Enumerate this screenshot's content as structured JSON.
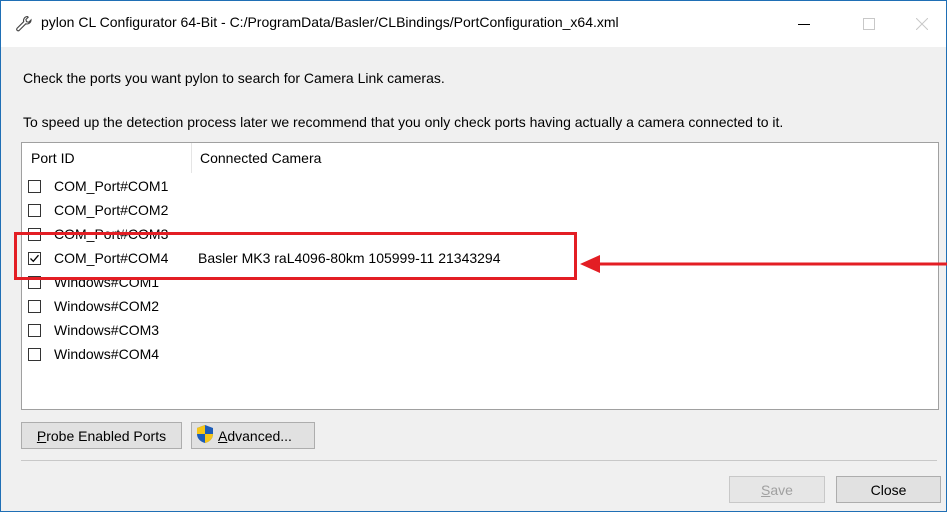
{
  "window": {
    "title": "pylon CL Configurator 64-Bit - C:/ProgramData/Basler/CLBindings/PortConfiguration_x64.xml",
    "icon": "wrench-icon"
  },
  "instructions": {
    "line1": "Check the ports you want pylon to search for Camera Link cameras.",
    "line2": "To speed up the detection process later we recommend that you only check ports having actually a camera connected to it."
  },
  "table": {
    "columns": [
      "Port ID",
      "Connected Camera"
    ],
    "rows": [
      {
        "port": "COM_Port#COM1",
        "camera": "",
        "checked": false
      },
      {
        "port": "COM_Port#COM2",
        "camera": "",
        "checked": false
      },
      {
        "port": "COM_Port#COM3",
        "camera": "",
        "checked": false
      },
      {
        "port": "COM_Port#COM4",
        "camera": "Basler MK3 raL4096-80km 105999-11 21343294",
        "checked": true
      },
      {
        "port": "Windows#COM1",
        "camera": "",
        "checked": false
      },
      {
        "port": "Windows#COM2",
        "camera": "",
        "checked": false
      },
      {
        "port": "Windows#COM3",
        "camera": "",
        "checked": false
      },
      {
        "port": "Windows#COM4",
        "camera": "",
        "checked": false
      }
    ]
  },
  "buttons": {
    "probe_prefix": "P",
    "probe_rest": "robe Enabled Ports",
    "advanced_prefix": "A",
    "advanced_rest": "dvanced...",
    "save_prefix": "S",
    "save_rest": "ave",
    "save_enabled": false,
    "close": "Close"
  },
  "colors": {
    "highlight": "#e31e24",
    "window_border": "#1f6fb5",
    "shield_blue": "#1c5cb8",
    "shield_yellow": "#f5c518"
  }
}
